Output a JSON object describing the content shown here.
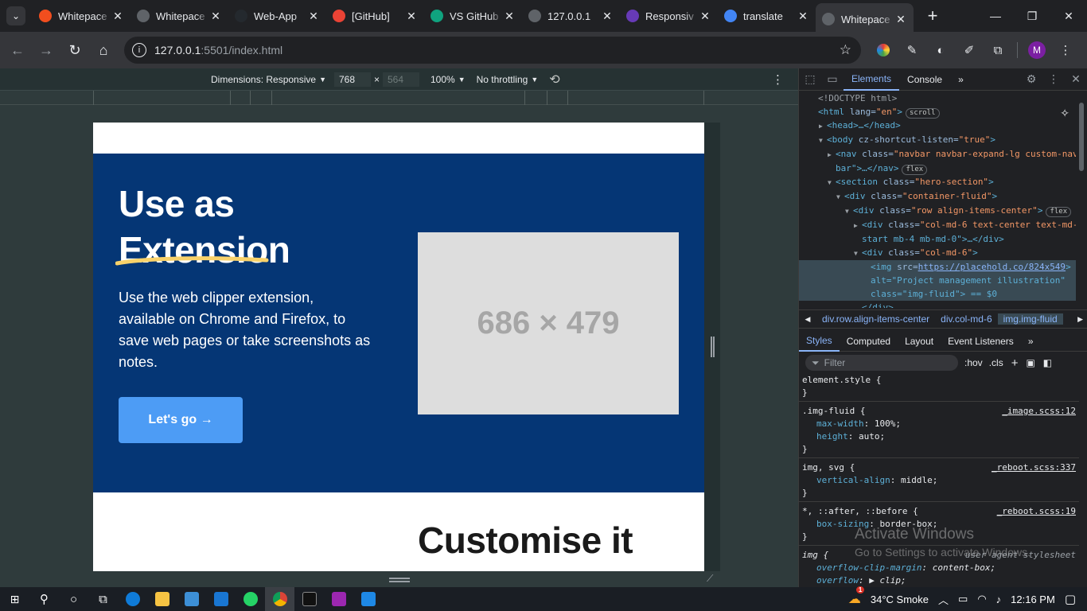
{
  "browser": {
    "tabs": [
      {
        "title": "Whitepace",
        "favicon": "figma-icon",
        "color": "#f24e1e",
        "active": false
      },
      {
        "title": "Whitepace",
        "favicon": "globe-icon",
        "color": "#5f6368",
        "active": false
      },
      {
        "title": "Web-App",
        "favicon": "github-icon",
        "color": "#24292e",
        "active": false
      },
      {
        "title": "[GitHub]",
        "favicon": "gmail-icon",
        "color": "#ea4335",
        "active": false
      },
      {
        "title": "VS GitHub",
        "favicon": "openai-icon",
        "color": "#10a37f",
        "active": false
      },
      {
        "title": "127.0.0.1",
        "favicon": "globe-icon",
        "color": "#5f6368",
        "active": false
      },
      {
        "title": "Responsiv",
        "favicon": "forms-icon",
        "color": "#673ab7",
        "active": false
      },
      {
        "title": "translate",
        "favicon": "google-icon",
        "color": "#4285f4",
        "active": false
      },
      {
        "title": "Whitepace",
        "favicon": "globe-icon",
        "color": "#5f6368",
        "active": true
      }
    ],
    "url_host": "127.0.0.1",
    "url_rest": ":5501/index.html",
    "profile_initial": "M"
  },
  "device_toolbar": {
    "dimensions_label": "Dimensions: Responsive",
    "width": "768",
    "height": "564",
    "times": "×",
    "zoom": "100%",
    "throttling": "No throttling"
  },
  "page": {
    "hero_title_line1": "Use as",
    "hero_title_line2": "Extension",
    "hero_text": "Use the web clipper extension, available on Chrome and Firefox, to save web pages or take screenshots as notes.",
    "cta_label": "Let's go →",
    "placeholder_text": "686 × 479",
    "next_section_title": "Customise it"
  },
  "devtools": {
    "tabs": [
      "Elements",
      "Console"
    ],
    "more_tabs": "»",
    "dom_lines": [
      {
        "indent": 0,
        "html": "<!DOCTYPE html>",
        "kind": "comment"
      },
      {
        "indent": 0,
        "tag": "html",
        "attrs": [
          [
            "lang",
            "\"en\""
          ]
        ],
        "badge": "scroll"
      },
      {
        "indent": 1,
        "tag": "head",
        "collapsed": true
      },
      {
        "indent": 1,
        "tag": "body",
        "attrs": [
          [
            "cz-shortcut-listen",
            "\"true\""
          ]
        ],
        "open": true
      },
      {
        "indent": 2,
        "tag": "nav",
        "attrs": [
          [
            "class",
            "\"navbar navbar-expand-lg custom-nav"
          ]
        ],
        "collapsed": false
      },
      {
        "indent": 2,
        "raw": "bar\">…</nav>",
        "badge": "flex"
      },
      {
        "indent": 2,
        "tag": "section",
        "attrs": [
          [
            "class",
            "\"hero-section\""
          ]
        ],
        "open": true
      },
      {
        "indent": 3,
        "tag": "div",
        "attrs": [
          [
            "class",
            "\"container-fluid\""
          ]
        ],
        "open": true
      },
      {
        "indent": 4,
        "tag": "div",
        "attrs": [
          [
            "class",
            "\"row align-items-center\""
          ]
        ],
        "badge": "flex",
        "open": true
      },
      {
        "indent": 5,
        "tag": "div",
        "attrs": [
          [
            "class",
            "\"col-md-6 text-center text-md-"
          ]
        ]
      },
      {
        "indent": 5,
        "raw": "start mb-4 mb-md-0\">…</div>"
      },
      {
        "indent": 5,
        "tag": "div",
        "attrs": [
          [
            "class",
            "\"col-md-6\""
          ]
        ],
        "open": true
      },
      {
        "indent": 6,
        "tag": "img",
        "attrs": [
          [
            "src",
            "https://placehold.co/824x549"
          ]
        ],
        "selected": true
      },
      {
        "indent": 6,
        "raw": "alt=\"Project management illustration\"",
        "selected": true
      },
      {
        "indent": 6,
        "raw": "class=\"img-fluid\"> == $0",
        "selected": true
      },
      {
        "indent": 5,
        "raw": "</div>"
      }
    ],
    "breadcrumbs": [
      "div.row.align-items-center",
      "div.col-md-6",
      "img.img-fluid"
    ],
    "styles_tabs": [
      "Styles",
      "Computed",
      "Layout",
      "Event Listeners"
    ],
    "filter_placeholder": "Filter",
    "hov_label": ":hov",
    "cls_label": ".cls",
    "rules": [
      {
        "selector": "element.style {",
        "source": "",
        "props": []
      },
      {
        "selector": ".img-fluid {",
        "source": "_image.scss:12",
        "props": [
          [
            "max-width",
            "100%;"
          ],
          [
            "height",
            "auto;"
          ]
        ]
      },
      {
        "selector": "img, svg {",
        "source": "_reboot.scss:337",
        "props": [
          [
            "vertical-align",
            "middle;"
          ]
        ]
      },
      {
        "selector": "*, ::after, ::before {",
        "source": "_reboot.scss:19",
        "props": [
          [
            "box-sizing",
            "border-box;"
          ]
        ]
      },
      {
        "selector": "img {",
        "source": "user agent stylesheet",
        "props": [
          [
            "overflow-clip-margin",
            "content-box;"
          ],
          [
            "overflow",
            "▶ clip;"
          ]
        ]
      }
    ],
    "activate_line1": "Activate Windows",
    "activate_line2": "Go to Settings to activate Windows."
  },
  "taskbar": {
    "weather": "34°C  Smoke",
    "time": "12:16 PM",
    "notif_count": "1"
  },
  "colors": {
    "hero_bg": "#053675",
    "cta_bg": "#4d9cf5",
    "devtools_accent": "#8ab4f8"
  }
}
